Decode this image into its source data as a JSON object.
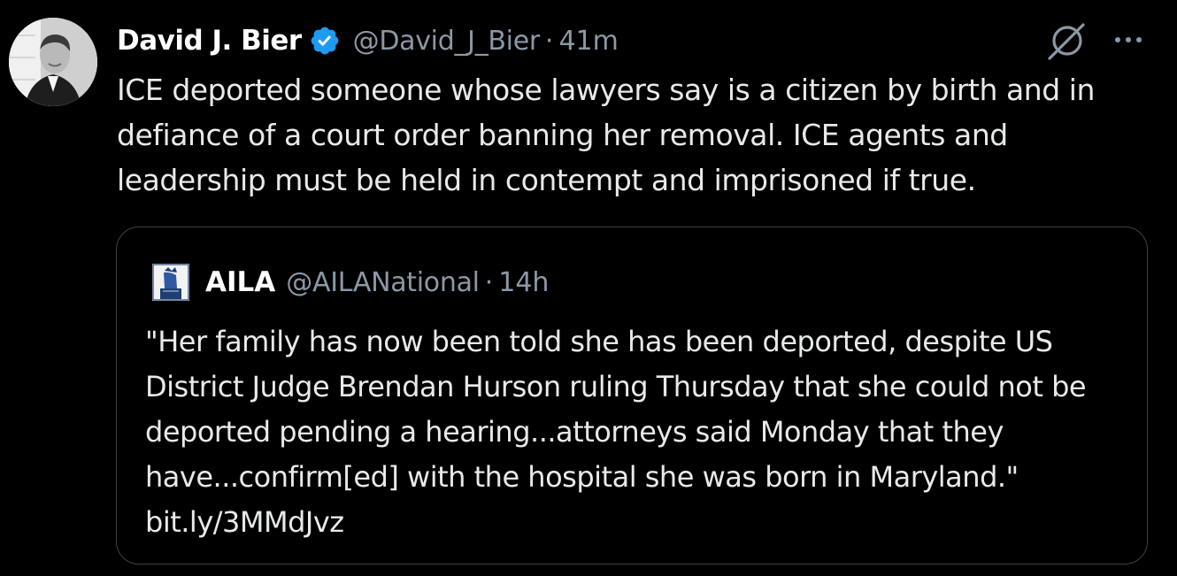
{
  "tweet": {
    "author": {
      "display_name": "David J. Bier",
      "handle": "@David_J_Bier",
      "verified": true
    },
    "separator": "·",
    "time": "41m",
    "text": "ICE deported someone whose lawyers say is a citizen by birth and in defiance of a court order banning her removal. ICE agents and leadership must be held in contempt and imprisoned if true."
  },
  "actions": {
    "grok_icon": "grok-icon",
    "more_icon": "more-icon"
  },
  "quoted_tweet": {
    "author": {
      "display_name": "AILA",
      "handle": "@AILANational"
    },
    "separator": "·",
    "time": "14h",
    "text": "\"Her family has now been told she has been deported, despite US District Judge Brendan Hurson ruling Thursday that she could not be deported pending a hearing...attorneys said Monday that they have...confirm[ed] with the hospital she was born in Maryland.\"",
    "link": "bit.ly/3MMdJvz"
  },
  "colors": {
    "background": "#000000",
    "primary_text": "#e7e9ea",
    "secondary_text": "#8b98a5",
    "verified_badge": "#1d9bf0",
    "quote_border": "#3e4144"
  }
}
